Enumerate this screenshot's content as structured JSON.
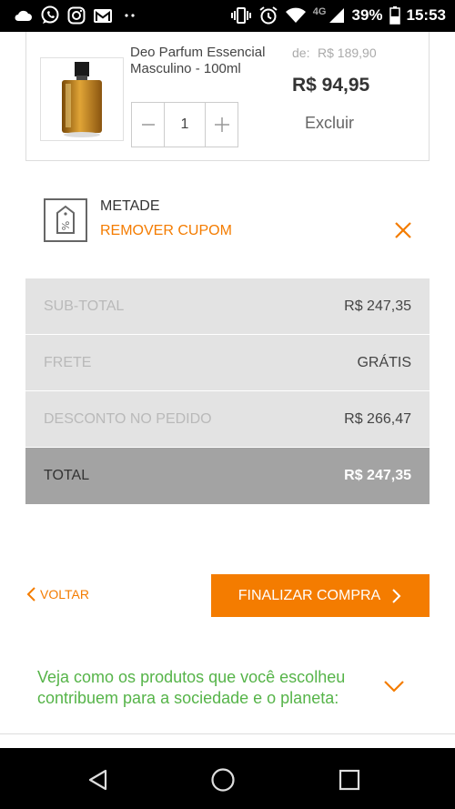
{
  "status_bar": {
    "network": "4G",
    "battery": "39%",
    "time": "15:53"
  },
  "product": {
    "name": "Deo Parfum Essencial Masculino - 100ml",
    "price_old_label": "de:",
    "price_old": "R$ 189,90",
    "price_current": "R$ 94,95",
    "quantity": "1",
    "remove_label": "Excluir"
  },
  "coupon": {
    "name": "METADE",
    "remove_label": "REMOVER CUPOM"
  },
  "totals": [
    {
      "label": "SUB-TOTAL",
      "value": "R$ 247,35"
    },
    {
      "label": "FRETE",
      "value": "GRÁTIS"
    },
    {
      "label": "DESCONTO NO PEDIDO",
      "value": "R$ 266,47"
    },
    {
      "label": "TOTAL",
      "value": "R$ 247,35"
    }
  ],
  "actions": {
    "back_label": "VOLTAR",
    "finish_label": "FINALIZAR COMPRA"
  },
  "info": {
    "text": "Veja como os produtos que você escolheu contribuem para a sociedade e o planeta:"
  },
  "colors": {
    "accent": "#f47c00",
    "info_green": "#56b449",
    "totals_bg": "#e3e3e3",
    "total_bg": "#a3a3a3"
  },
  "icons": {
    "status_left": [
      "cloud-icon",
      "whatsapp-icon",
      "instagram-icon",
      "gmail-icon",
      "more-dots-icon"
    ],
    "status_right": [
      "vibrate-icon",
      "alarm-icon",
      "wifi-icon",
      "signal-icon",
      "battery-icon"
    ],
    "nav": [
      "back-triangle-icon",
      "home-circle-icon",
      "recents-square-icon"
    ]
  }
}
